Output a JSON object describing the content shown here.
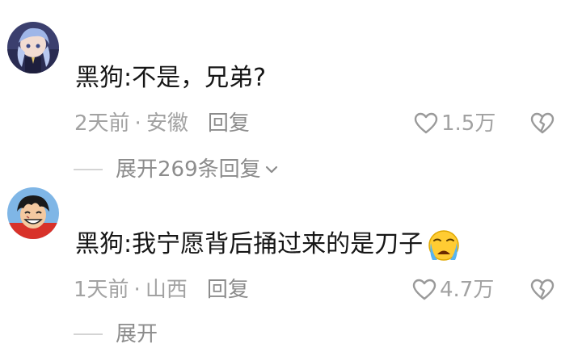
{
  "comments": [
    {
      "text": "黑狗:不是，兄弟?",
      "time": "2天前",
      "location": "安徽",
      "reply_label": "回复",
      "likes": "1.5万",
      "expand_label": "展开269条回复"
    },
    {
      "text": "黑狗:我宁愿背后捅过来的是刀子",
      "time": "1天前",
      "location": "山西",
      "reply_label": "回复",
      "likes": "4.7万",
      "expand_label": "展开"
    }
  ],
  "separator": "·",
  "icons": {
    "like": "heart-outline-icon",
    "dislike": "broken-heart-icon",
    "expand": "chevron-down-icon",
    "emoji": "crying-face-emoji"
  }
}
